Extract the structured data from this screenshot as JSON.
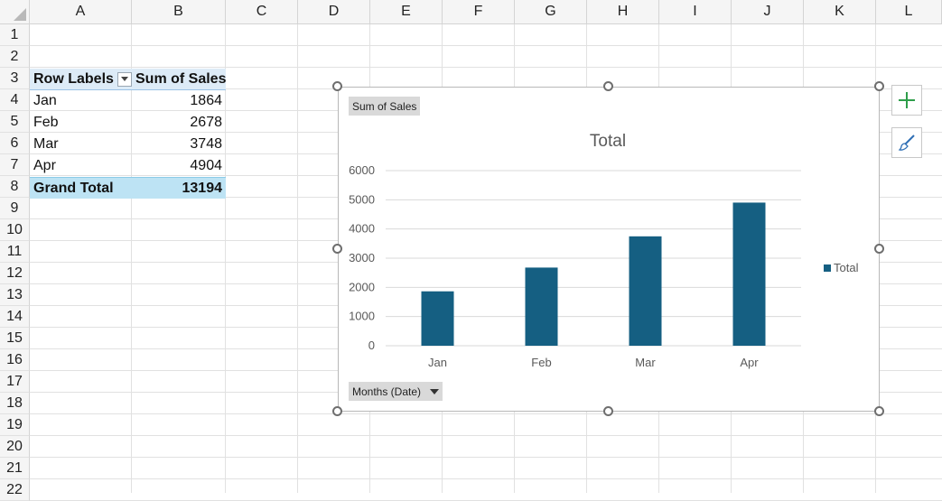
{
  "columns": [
    "A",
    "B",
    "C",
    "D",
    "E",
    "F",
    "G",
    "H",
    "I",
    "J",
    "K",
    "L"
  ],
  "rows": [
    "1",
    "2",
    "3",
    "4",
    "5",
    "6",
    "7",
    "8",
    "9",
    "10",
    "11",
    "12",
    "13",
    "14",
    "15",
    "16",
    "17",
    "18",
    "19",
    "20",
    "21",
    "22"
  ],
  "pivot": {
    "header_row_labels": "Row Labels",
    "header_sum_of_sales": "Sum of Sales",
    "rows": [
      {
        "label": "Jan",
        "value": "1864"
      },
      {
        "label": "Feb",
        "value": "2678"
      },
      {
        "label": "Mar",
        "value": "3748"
      },
      {
        "label": "Apr",
        "value": "4904"
      }
    ],
    "grand_total_label": "Grand Total",
    "grand_total_value": "13194"
  },
  "chart": {
    "value_field_button": "Sum of Sales",
    "axis_field_button": "Months (Date)"
  },
  "chart_data": {
    "type": "bar",
    "title": "Total",
    "categories": [
      "Jan",
      "Feb",
      "Mar",
      "Apr"
    ],
    "series": [
      {
        "name": "Total",
        "values": [
          1864,
          2678,
          3748,
          4904
        ],
        "color": "#155f82"
      }
    ],
    "ylim": [
      0,
      6000
    ],
    "yticks": [
      "0",
      "1000",
      "2000",
      "3000",
      "4000",
      "5000",
      "6000"
    ],
    "legend_position": "right",
    "grid": true
  },
  "side_buttons": {
    "add_elements_icon": "plus-icon",
    "styles_icon": "brush-icon"
  }
}
